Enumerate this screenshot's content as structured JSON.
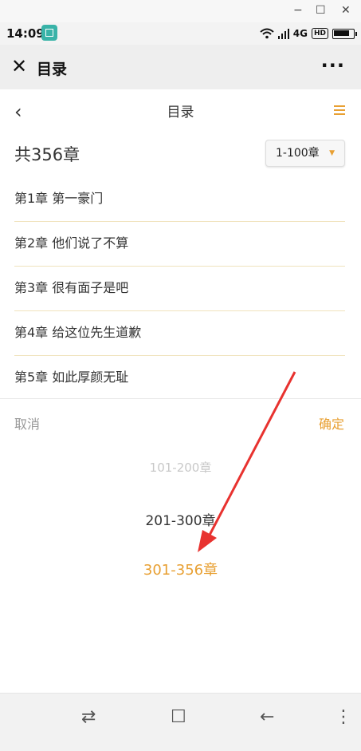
{
  "window": {
    "minimize": "−",
    "maximize": "☐",
    "close": "✕"
  },
  "status_bar": {
    "time": "14:09",
    "network": "4G",
    "hd": "HD"
  },
  "wechat_bar": {
    "close_icon": "✕",
    "title": "目录",
    "more_icon": "···"
  },
  "page": {
    "back_icon": "‹",
    "title": "目录",
    "menu_icon": "menu-icon",
    "total_chapters": "共356章",
    "range_select": {
      "value": "1-100章",
      "caret": "▼"
    },
    "chapters": [
      "第1章 第一豪门",
      "第2章 他们说了不算",
      "第3章 很有面子是吧",
      "第4章 给这位先生道歉",
      "第5章 如此厚颜无耻"
    ]
  },
  "picker": {
    "cancel_label": "取消",
    "confirm_label": "确定",
    "options": [
      "101-200章",
      "201-300章",
      "301-356章"
    ],
    "selected_index": 2
  },
  "nav_bar": {
    "switch_icon": "⇄",
    "home_icon": "☐",
    "back_icon": "←",
    "menu_icon": "⋮"
  },
  "colors": {
    "accent": "#e8a033",
    "annotation": "#e8322f"
  }
}
